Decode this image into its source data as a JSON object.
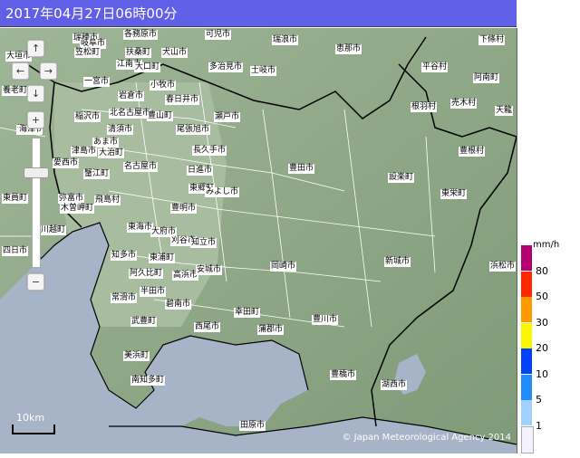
{
  "header": {
    "title": "2017年04月27日06時00分"
  },
  "map": {
    "scale_label": "10km",
    "copyright": "© Japan Meteorological Agency 2014",
    "places": [
      {
        "name": "瑞穂市"
      },
      {
        "name": "岐阜市"
      },
      {
        "name": "各務原市"
      },
      {
        "name": "可児市"
      },
      {
        "name": "瑞浪市"
      },
      {
        "name": "恵那市"
      },
      {
        "name": "下條村"
      },
      {
        "name": "大垣市"
      },
      {
        "name": "笠松町"
      },
      {
        "name": "扶桑町"
      },
      {
        "name": "犬山市"
      },
      {
        "name": "多治見市"
      },
      {
        "name": "土岐市"
      },
      {
        "name": "一宮市"
      },
      {
        "name": "江南市"
      },
      {
        "name": "大口町"
      },
      {
        "name": "平谷村"
      },
      {
        "name": "小牧市"
      },
      {
        "name": "阿南町"
      },
      {
        "name": "岩倉市"
      },
      {
        "name": "春日井市"
      },
      {
        "name": "根羽村"
      },
      {
        "name": "売木村"
      },
      {
        "name": "北名古屋市"
      },
      {
        "name": "豊山町"
      },
      {
        "name": "稲沢市"
      },
      {
        "name": "瀬戸市"
      },
      {
        "name": "天龍"
      },
      {
        "name": "海津市"
      },
      {
        "name": "清須市"
      },
      {
        "name": "尾張旭市"
      },
      {
        "name": "あま市"
      },
      {
        "name": "津島市"
      },
      {
        "name": "大治町"
      },
      {
        "name": "長久手市"
      },
      {
        "name": "豊根村"
      },
      {
        "name": "愛西市"
      },
      {
        "name": "名古屋市"
      },
      {
        "name": "蟹江町"
      },
      {
        "name": "日進市"
      },
      {
        "name": "豊田市"
      },
      {
        "name": "設楽町"
      },
      {
        "name": "東郷町"
      },
      {
        "name": "みよし市"
      },
      {
        "name": "東栄町"
      },
      {
        "name": "弥富市"
      },
      {
        "name": "飛島村"
      },
      {
        "name": "東員町"
      },
      {
        "name": "木曽岬町"
      },
      {
        "name": "豊明市"
      },
      {
        "name": "東海市"
      },
      {
        "name": "大府市"
      },
      {
        "name": "川越町"
      },
      {
        "name": "刈谷市"
      },
      {
        "name": "知立市"
      },
      {
        "name": "知多市"
      },
      {
        "name": "東浦町"
      },
      {
        "name": "岡崎市"
      },
      {
        "name": "新城市"
      },
      {
        "name": "浜松市"
      },
      {
        "name": "阿久比町"
      },
      {
        "name": "高浜市"
      },
      {
        "name": "安城市"
      },
      {
        "name": "半田市"
      },
      {
        "name": "常滑市"
      },
      {
        "name": "碧南市"
      },
      {
        "name": "幸田町"
      },
      {
        "name": "武豊町"
      },
      {
        "name": "西尾市"
      },
      {
        "name": "蒲郡市"
      },
      {
        "name": "豊川市"
      },
      {
        "name": "美浜町"
      },
      {
        "name": "豊橋市"
      },
      {
        "name": "湖西市"
      },
      {
        "name": "南知多町"
      },
      {
        "name": "田原市"
      },
      {
        "name": "四日市"
      },
      {
        "name": "養老町"
      },
      {
        "name": "海津"
      }
    ]
  },
  "legend": {
    "unit": "mm/h",
    "levels": [
      {
        "label": "80",
        "color": "#b4006e"
      },
      {
        "label": "50",
        "color": "#ff2800"
      },
      {
        "label": "30",
        "color": "#ff9900"
      },
      {
        "label": "20",
        "color": "#faf500"
      },
      {
        "label": "10",
        "color": "#0041ff"
      },
      {
        "label": "5",
        "color": "#218cff"
      },
      {
        "label": "1",
        "color": "#a0d2ff"
      },
      {
        "label": "",
        "color": "#f2f2ff"
      }
    ]
  },
  "controls": {
    "pan_up": "↑",
    "pan_left": "←",
    "pan_right": "→",
    "pan_down": "↓",
    "zoom_in": "+",
    "zoom_out": "−"
  }
}
